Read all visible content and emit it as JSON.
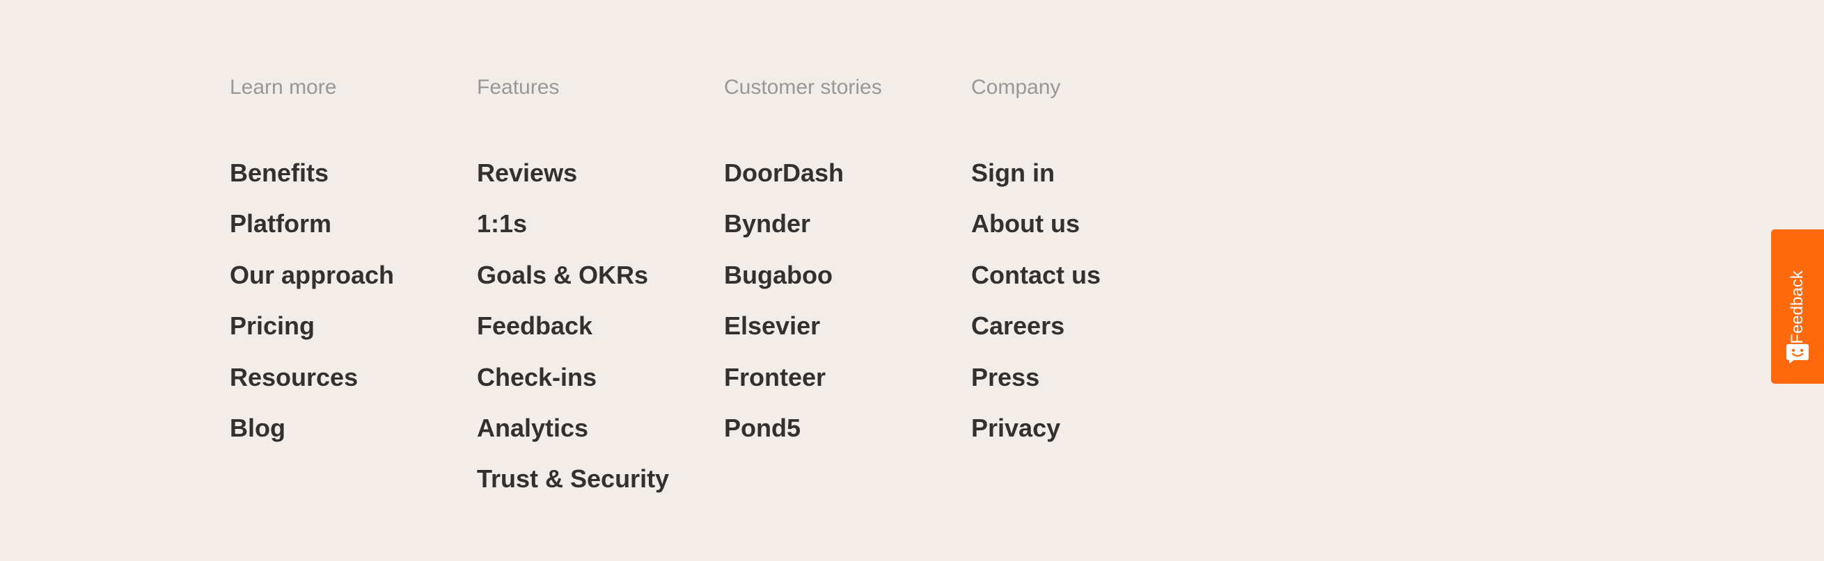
{
  "footer": {
    "columns": [
      {
        "heading": "Learn more",
        "links": [
          "Benefits",
          "Platform",
          "Our approach",
          "Pricing",
          "Resources",
          "Blog"
        ]
      },
      {
        "heading": "Features",
        "links": [
          "Reviews",
          "1:1s",
          "Goals & OKRs",
          "Feedback",
          "Check-ins",
          "Analytics",
          "Trust & Security"
        ]
      },
      {
        "heading": "Customer stories",
        "links": [
          "DoorDash",
          "Bynder",
          "Bugaboo",
          "Elsevier",
          "Fronteer",
          "Pond5"
        ]
      },
      {
        "heading": "Company",
        "links": [
          "Sign in",
          "About us",
          "Contact us",
          "Careers",
          "Press",
          "Privacy"
        ]
      }
    ]
  },
  "feedback_widget": {
    "label": "Feedback",
    "icon": "chat-face-icon",
    "color": "#ff6a0f"
  },
  "colors": {
    "background": "#f2ede8",
    "heading": "#9a9794",
    "link": "#33302e"
  }
}
